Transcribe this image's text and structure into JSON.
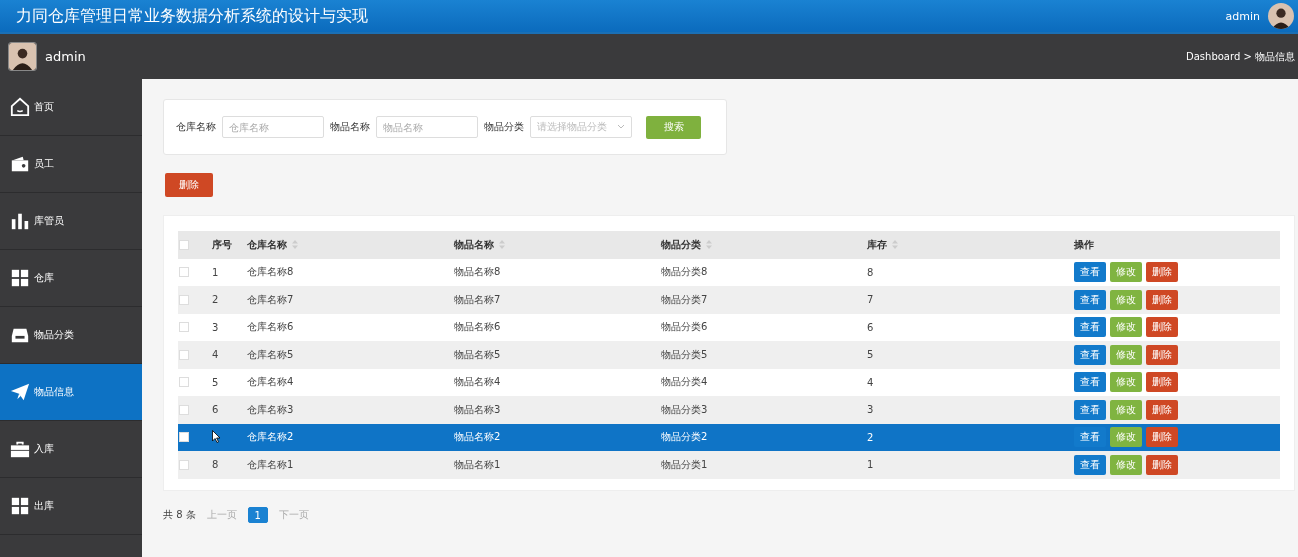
{
  "header": {
    "title": "力同仓库管理日常业务数据分析系统的设计与实现",
    "user": "admin"
  },
  "subbar": {
    "user": "admin",
    "breadcrumb": "Dashboard > 物品信息"
  },
  "sidebar": {
    "items": [
      {
        "label": "首页",
        "selected": false
      },
      {
        "label": "员工",
        "selected": false
      },
      {
        "label": "库管员",
        "selected": false
      },
      {
        "label": "仓库",
        "selected": false
      },
      {
        "label": "物品分类",
        "selected": false
      },
      {
        "label": "物品信息",
        "selected": true
      },
      {
        "label": "入库",
        "selected": false
      },
      {
        "label": "出库",
        "selected": false
      }
    ]
  },
  "search": {
    "fields": [
      {
        "label": "仓库名称",
        "placeholder": "仓库名称",
        "kind": "text"
      },
      {
        "label": "物品名称",
        "placeholder": "物品名称",
        "kind": "text"
      },
      {
        "label": "物品分类",
        "placeholder": "请选择物品分类",
        "kind": "select"
      }
    ],
    "button": "搜索"
  },
  "bulk_delete": "删除",
  "table": {
    "columns": [
      {
        "label": "序号",
        "sortable": false
      },
      {
        "label": "仓库名称",
        "sortable": true
      },
      {
        "label": "物品名称",
        "sortable": true
      },
      {
        "label": "物品分类",
        "sortable": true
      },
      {
        "label": "库存",
        "sortable": true
      },
      {
        "label": "操作",
        "sortable": false
      }
    ],
    "header_checked": false,
    "rows": [
      {
        "index": "1",
        "warehouse": "仓库名称8",
        "item": "物品名称8",
        "category": "物品分类8",
        "stock": "8",
        "selected": false,
        "checked": false,
        "actions": [
          "查看",
          "修改",
          "删除"
        ]
      },
      {
        "index": "2",
        "warehouse": "仓库名称7",
        "item": "物品名称7",
        "category": "物品分类7",
        "stock": "7",
        "selected": false,
        "checked": false,
        "actions": [
          "查看",
          "修改",
          "删除"
        ]
      },
      {
        "index": "3",
        "warehouse": "仓库名称6",
        "item": "物品名称6",
        "category": "物品分类6",
        "stock": "6",
        "selected": false,
        "checked": false,
        "actions": [
          "查看",
          "修改",
          "删除"
        ]
      },
      {
        "index": "4",
        "warehouse": "仓库名称5",
        "item": "物品名称5",
        "category": "物品分类5",
        "stock": "5",
        "selected": false,
        "checked": false,
        "actions": [
          "查看",
          "修改",
          "删除"
        ]
      },
      {
        "index": "5",
        "warehouse": "仓库名称4",
        "item": "物品名称4",
        "category": "物品分类4",
        "stock": "4",
        "selected": false,
        "checked": false,
        "actions": [
          "查看",
          "修改",
          "删除"
        ]
      },
      {
        "index": "6",
        "warehouse": "仓库名称3",
        "item": "物品名称3",
        "category": "物品分类3",
        "stock": "3",
        "selected": false,
        "checked": false,
        "actions": [
          "查看",
          "修改",
          "删除"
        ]
      },
      {
        "warehouse": "仓库名称2",
        "item": "物品名称2",
        "category": "物品分类2",
        "stock": "2",
        "selected": true,
        "checked": false,
        "actions": [
          "查看",
          "修改",
          "删除"
        ]
      },
      {
        "index": "8",
        "warehouse": "仓库名称1",
        "item": "物品名称1",
        "category": "物品分类1",
        "stock": "1",
        "selected": false,
        "checked": false,
        "actions": [
          "查看",
          "修改",
          "删除"
        ]
      }
    ]
  },
  "pagination": {
    "total": "共 8 条",
    "prev": "上一页",
    "pages": [
      {
        "label": "1",
        "selected": true
      }
    ],
    "next": "下一页"
  }
}
